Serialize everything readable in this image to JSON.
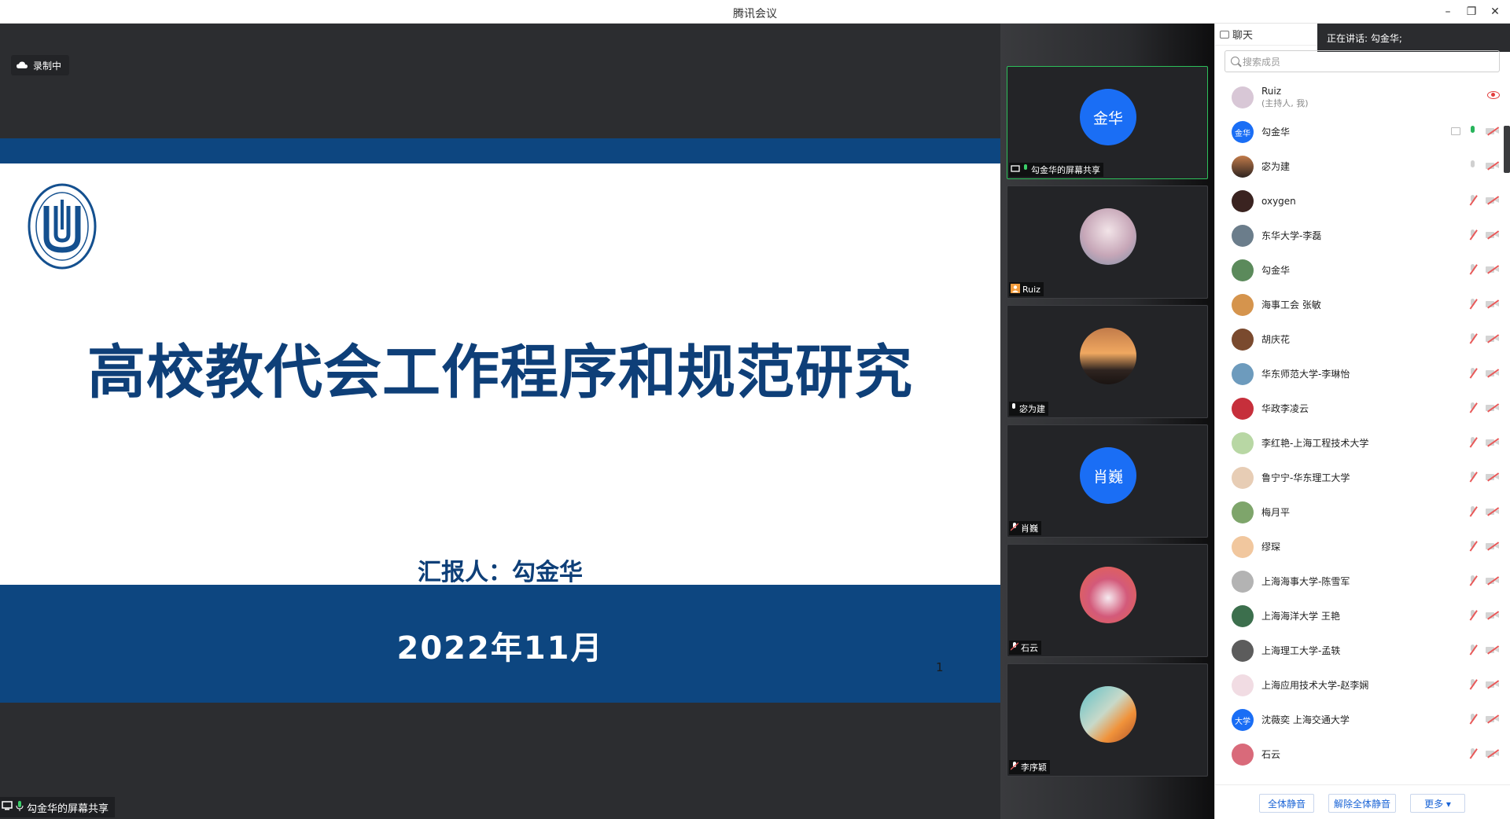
{
  "window": {
    "title": "腾讯会议",
    "controls": {
      "minimize": "–",
      "restore": "❐",
      "close": "✕"
    }
  },
  "stage": {
    "recording_label": "录制中",
    "share_label": "勾金华的屏幕共享",
    "slide": {
      "title": "高校教代会工作程序和规范研究",
      "reporter": "汇报人：勾金华",
      "date": "2022年11月",
      "page_number": "1"
    }
  },
  "video_strip": {
    "tiles": [
      {
        "avatar_text": "金华",
        "avatar_color": "#1a6ef5",
        "label": "勾金华的屏幕共享",
        "active": true
      },
      {
        "avatar_text": "",
        "avatar_color": "#c9b9d2",
        "label": "Ruiz",
        "active": false
      },
      {
        "avatar_text": "",
        "avatar_color": "#5b3b2b",
        "label": "宓为建",
        "active": false
      },
      {
        "avatar_text": "肖巍",
        "avatar_color": "#1a6ef5",
        "label": "肖巍",
        "active": false
      },
      {
        "avatar_text": "",
        "avatar_color": "#c7536b",
        "label": "石云",
        "active": false
      },
      {
        "avatar_text": "",
        "avatar_color": "#3aa6b5",
        "label": "李序颖",
        "active": false
      }
    ]
  },
  "sidebar": {
    "tab_label": "聊天",
    "speaking_text": "正在讲话: 勾金华;",
    "search_placeholder": "搜索成员",
    "members": [
      {
        "name": "Ruiz",
        "sub": "(主持人, 我)",
        "avatar_text": "",
        "avatar_color": "#d8c7d6"
      },
      {
        "name": "勾金华",
        "sub": "",
        "avatar_text": "金华",
        "avatar_color": "#1a6ef5"
      },
      {
        "name": "宓为建",
        "sub": "",
        "avatar_text": "",
        "avatar_color": "#8a5a3a"
      },
      {
        "name": "oxygen",
        "sub": "",
        "avatar_text": "",
        "avatar_color": "#3a2320"
      },
      {
        "name": "东华大学-李磊",
        "sub": "",
        "avatar_text": "",
        "avatar_color": "#6b7d8b"
      },
      {
        "name": "勾金华",
        "sub": "",
        "avatar_text": "",
        "avatar_color": "#5b8a5b"
      },
      {
        "name": "海事工会 张敏",
        "sub": "",
        "avatar_text": "",
        "avatar_color": "#d5944d"
      },
      {
        "name": "胡庆花",
        "sub": "",
        "avatar_text": "",
        "avatar_color": "#7a4a2e"
      },
      {
        "name": "华东师范大学-李琳怡",
        "sub": "",
        "avatar_text": "",
        "avatar_color": "#6d9bbd"
      },
      {
        "name": "华政李凌云",
        "sub": "",
        "avatar_text": "",
        "avatar_color": "#c62f3b"
      },
      {
        "name": "李红艳-上海工程技术大学",
        "sub": "",
        "avatar_text": "",
        "avatar_color": "#b8d7a4"
      },
      {
        "name": "鲁宁宁-华东理工大学",
        "sub": "",
        "avatar_text": "",
        "avatar_color": "#e7cdb5"
      },
      {
        "name": "梅月平",
        "sub": "",
        "avatar_text": "",
        "avatar_color": "#7ea56b"
      },
      {
        "name": "缪琛",
        "sub": "",
        "avatar_text": "",
        "avatar_color": "#f1c79e"
      },
      {
        "name": "上海海事大学-陈雪军",
        "sub": "",
        "avatar_text": "",
        "avatar_color": "#b3b3b3"
      },
      {
        "name": "上海海洋大学 王艳",
        "sub": "",
        "avatar_text": "",
        "avatar_color": "#3c6f4d"
      },
      {
        "name": "上海理工大学-孟轶",
        "sub": "",
        "avatar_text": "",
        "avatar_color": "#5c5c5c"
      },
      {
        "name": "上海应用技术大学-赵李娴",
        "sub": "",
        "avatar_text": "",
        "avatar_color": "#f1dce3"
      },
      {
        "name": "沈薇奕 上海交通大学",
        "sub": "",
        "avatar_text": "大学",
        "avatar_color": "#1a6ef5"
      },
      {
        "name": "石云",
        "sub": "",
        "avatar_text": "",
        "avatar_color": "#d96a7a"
      }
    ],
    "footer": {
      "mute_all": "全体静音",
      "unmute_all": "解除全体静音",
      "more": "更多 ▾"
    }
  },
  "colors": {
    "slide_band": "#0d4680",
    "slide_text": "#0e3f78",
    "active_border": "#2dbf5a",
    "accent": "#1a64d6"
  }
}
